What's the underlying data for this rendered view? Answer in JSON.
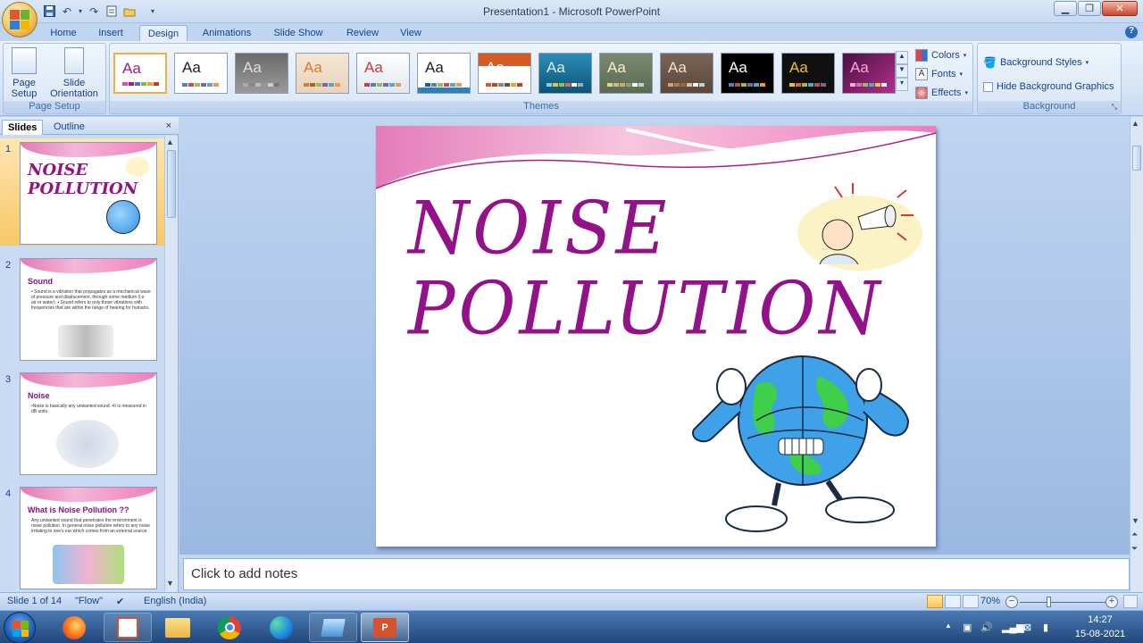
{
  "window": {
    "title": "Presentation1 - Microsoft PowerPoint"
  },
  "ribbon": {
    "tabs": [
      "Home",
      "Insert",
      "Design",
      "Animations",
      "Slide Show",
      "Review",
      "View"
    ],
    "active_tab": "Design",
    "page_setup": {
      "page_setup_label": "Page Setup",
      "slide_orientation_label": "Slide Orientation",
      "group_label": "Page Setup"
    },
    "themes": {
      "group_label": "Themes",
      "sample_text": "Aa"
    },
    "theme_options": {
      "colors_label": "Colors",
      "fonts_label": "Fonts",
      "effects_label": "Effects"
    },
    "background": {
      "styles_label": "Background Styles",
      "hide_graphics_label": "Hide Background Graphics",
      "group_label": "Background"
    }
  },
  "left_pane": {
    "tabs": [
      "Slides",
      "Outline"
    ],
    "close_glyph": "×",
    "slides": [
      {
        "num": "1",
        "title": "NOISE\nPOLLUTION",
        "body": ""
      },
      {
        "num": "2",
        "title": "Sound",
        "body": "• Sound is a vibration that propagates as a mechanical wave of pressure and displacement, through some medium (i.e. air or water). • Sound refers to only those vibrations with frequencies that are within the range of hearing for humans."
      },
      {
        "num": "3",
        "title": "Noise",
        "body": "•Noise is basically any unwanted sound. •It is measured in dB units"
      },
      {
        "num": "4",
        "title": "What is Noise Pollution ??",
        "body": "Any unwanted sound that penetrates the environment is noise pollution. In general noise pollution refers to any noise irritating to one's ear which comes from an external source."
      }
    ]
  },
  "slide": {
    "title_line1": "NOISE",
    "title_line2": "POLLUTION"
  },
  "notes": {
    "placeholder": "Click to add notes"
  },
  "status": {
    "slide_counter": "Slide 1 of 14",
    "theme_name": "\"Flow\"",
    "language": "English (India)",
    "zoom": "70%"
  },
  "taskbar": {
    "time": "14:27",
    "date": "15-08-2021"
  }
}
